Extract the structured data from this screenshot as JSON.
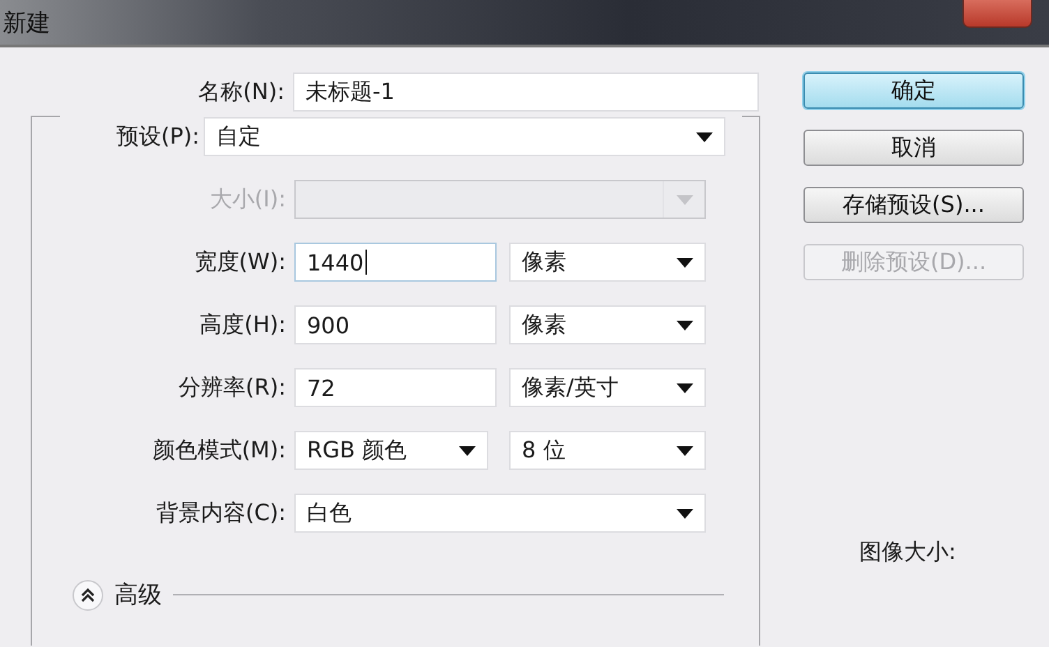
{
  "window": {
    "title": "新建"
  },
  "name": {
    "label": "名称(N):",
    "value": "未标题-1"
  },
  "preset": {
    "label": "预设(P):",
    "value": "自定"
  },
  "rows": [
    {
      "kind": "select",
      "label": "大小(I):",
      "disabled": true
    },
    {
      "kind": "input_unit",
      "label": "宽度(W):",
      "value": "1440",
      "focused": true,
      "unit": "像素"
    },
    {
      "kind": "input_unit",
      "label": "高度(H):",
      "value": "900",
      "focused": false,
      "unit": "像素"
    },
    {
      "kind": "input_unit",
      "label": "分辨率(R):",
      "value": "72",
      "focused": false,
      "unit": "像素/英寸"
    },
    {
      "kind": "select_pair",
      "label": "颜色模式(M):",
      "value": "RGB 颜色",
      "unit": "8 位"
    },
    {
      "kind": "select",
      "label": "背景内容(C):",
      "value": "白色",
      "disabled": false
    }
  ],
  "advanced": {
    "label": "高级"
  },
  "buttons": [
    {
      "label": "确定",
      "default": true,
      "disabled": false
    },
    {
      "label": "取消",
      "default": false,
      "disabled": false
    },
    {
      "label": "存储预设(S)...",
      "default": false,
      "disabled": false
    },
    {
      "label": "删除预设(D)...",
      "default": false,
      "disabled": true
    }
  ],
  "image_size_label": "图像大小:"
}
